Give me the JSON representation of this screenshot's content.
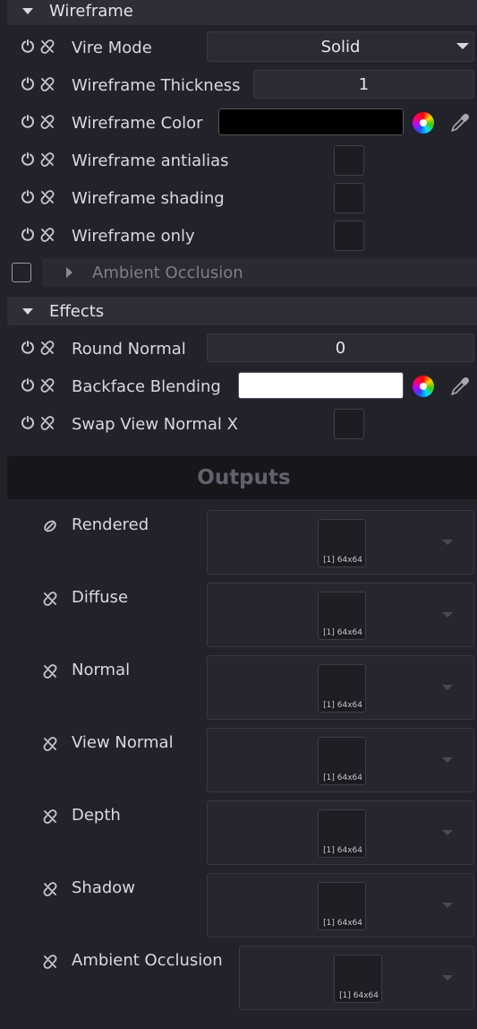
{
  "wireframe": {
    "title": "Wireframe",
    "vire_mode": {
      "label": "Vire Mode",
      "value": "Solid"
    },
    "thickness": {
      "label": "Wireframe Thickness",
      "value": "1"
    },
    "color": {
      "label": "Wireframe Color",
      "value": "#000000"
    },
    "antialias": {
      "label": "Wireframe antialias"
    },
    "shading": {
      "label": "Wireframe shading"
    },
    "only": {
      "label": "Wireframe only"
    }
  },
  "ambient_occlusion_section": {
    "title": "Ambient Occlusion"
  },
  "effects": {
    "title": "Effects",
    "round_normal": {
      "label": "Round Normal",
      "value": "0"
    },
    "backface": {
      "label": "Backface Blending",
      "value": "#ffffff"
    },
    "swap_view_normal_x": {
      "label": "Swap View Normal X"
    }
  },
  "outputs": {
    "title": "Outputs",
    "items": [
      {
        "label": "Rendered",
        "thumb": "[1] 64x64"
      },
      {
        "label": "Diffuse",
        "thumb": "[1] 64x64"
      },
      {
        "label": "Normal",
        "thumb": "[1] 64x64"
      },
      {
        "label": "View Normal",
        "thumb": "[1] 64x64"
      },
      {
        "label": "Depth",
        "thumb": "[1] 64x64"
      },
      {
        "label": "Shadow",
        "thumb": "[1] 64x64"
      },
      {
        "label": "Ambient Occlusion",
        "thumb": "[1] 64x64"
      }
    ]
  }
}
